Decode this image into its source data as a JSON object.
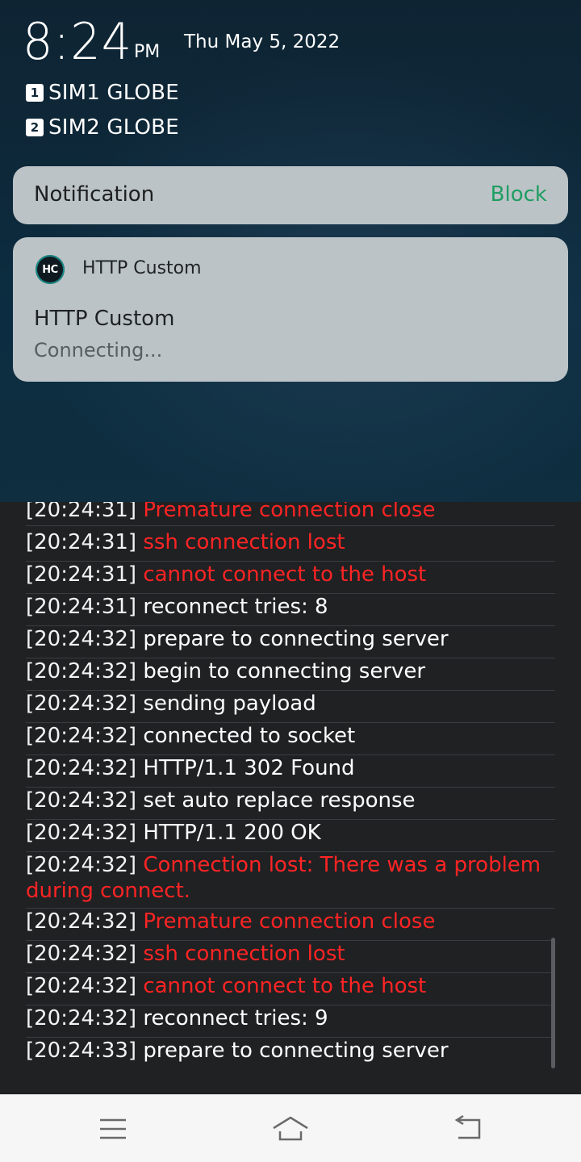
{
  "status": {
    "time": "8:24",
    "ampm": "PM",
    "date": "Thu May 5, 2022",
    "sims": [
      {
        "badge": "1",
        "label": "SIM1 GLOBE"
      },
      {
        "badge": "2",
        "label": "SIM2 GLOBE"
      }
    ]
  },
  "notification_header": {
    "title": "Notification",
    "action": "Block"
  },
  "notification": {
    "icon_text": "HC",
    "app_name": "HTTP Custom",
    "title": "HTTP Custom",
    "text": "Connecting..."
  },
  "log": [
    {
      "time": "[20:24:31]",
      "msg": "Premature connection close",
      "error": true
    },
    {
      "time": "[20:24:31]",
      "msg": "ssh connection lost",
      "error": true
    },
    {
      "time": "[20:24:31]",
      "msg": "cannot connect to the host",
      "error": true
    },
    {
      "time": "[20:24:31]",
      "msg": "reconnect tries: 8",
      "error": false
    },
    {
      "time": "[20:24:32]",
      "msg": "prepare to connecting server",
      "error": false
    },
    {
      "time": "[20:24:32]",
      "msg": "begin to connecting server",
      "error": false
    },
    {
      "time": "[20:24:32]",
      "msg": "sending payload",
      "error": false
    },
    {
      "time": "[20:24:32]",
      "msg": "connected to socket",
      "error": false
    },
    {
      "time": "[20:24:32]",
      "msg": "HTTP/1.1 302 Found",
      "error": false
    },
    {
      "time": "[20:24:32]",
      "msg": "set auto replace response",
      "error": false
    },
    {
      "time": "[20:24:32]",
      "msg": "HTTP/1.1 200 OK",
      "error": false
    },
    {
      "time": "[20:24:32]",
      "msg": "Connection lost: There was a problem during connect.",
      "error": true
    },
    {
      "time": "[20:24:32]",
      "msg": "Premature connection close",
      "error": true
    },
    {
      "time": "[20:24:32]",
      "msg": "ssh connection lost",
      "error": true
    },
    {
      "time": "[20:24:32]",
      "msg": "cannot connect to the host",
      "error": true
    },
    {
      "time": "[20:24:32]",
      "msg": "reconnect tries: 9",
      "error": false
    },
    {
      "time": "[20:24:33]",
      "msg": "prepare to connecting server",
      "error": false
    }
  ],
  "navbar": {
    "icons": [
      "menu-icon",
      "home-icon",
      "back-icon"
    ]
  },
  "colors": {
    "error_text": "#ff2424",
    "block_action": "#1f9d63",
    "log_background": "#1f2123",
    "navbar_background": "#f6f6f6"
  }
}
